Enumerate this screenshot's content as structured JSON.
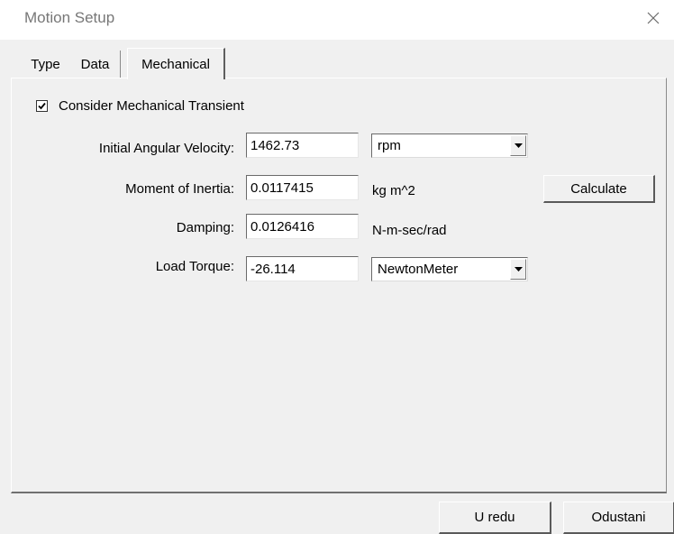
{
  "window": {
    "title": "Motion Setup",
    "close_icon": "close-icon"
  },
  "tabs": [
    {
      "label": "Type",
      "active": false
    },
    {
      "label": "Data",
      "active": false
    },
    {
      "label": "Mechanical",
      "active": true
    }
  ],
  "mechanical": {
    "consider_transient": {
      "label": "Consider Mechanical Transient",
      "checked": true
    },
    "initial_angular_velocity": {
      "label": "Initial Angular Velocity:",
      "value": "1462.73",
      "unit": "rpm"
    },
    "moment_of_inertia": {
      "label": "Moment of Inertia:",
      "value": "0.0117415",
      "unit": "kg m^2"
    },
    "damping": {
      "label": "Damping:",
      "value": "0.0126416",
      "unit": "N-m-sec/rad"
    },
    "load_torque": {
      "label": "Load Torque:",
      "value": "-26.114",
      "unit": "NewtonMeter"
    },
    "calculate_label": "Calculate"
  },
  "footer": {
    "ok_label": "U redu",
    "cancel_label": "Odustani"
  }
}
